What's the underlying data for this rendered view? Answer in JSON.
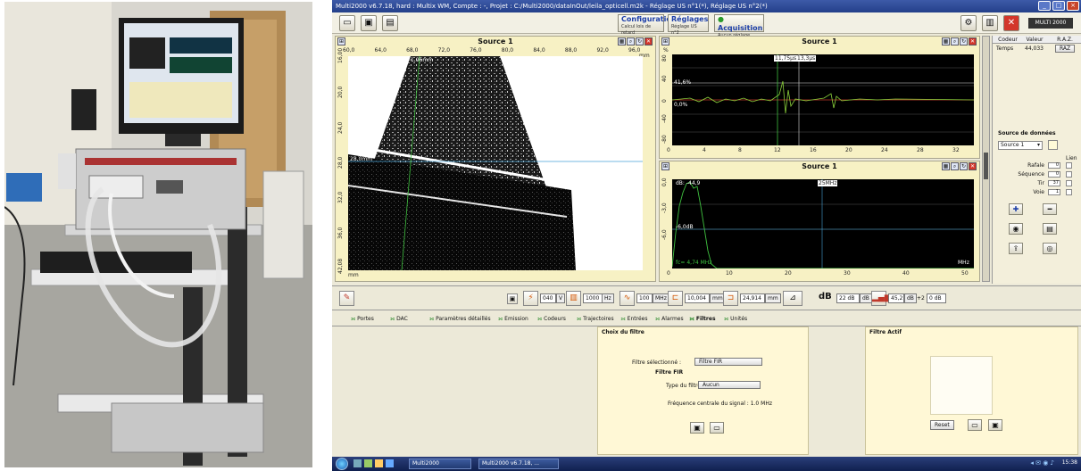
{
  "window": {
    "title": "Multi2000  v6.7.18,  hard : Multix WM, Compte : -,  Projet : C:/Multi2000/dataInOut/leila_opticell.m2k - Réglage US n°1(*), Réglage US n°2(*)"
  },
  "toolbar": {
    "configuration": {
      "title": "Configuration",
      "subtitle": "Calcul lois de retard"
    },
    "reglages": {
      "title": "Réglages",
      "subtitle": "Réglage US n°2"
    },
    "acquisition": {
      "title": "Acquisition",
      "subtitle": "Aucun réglage"
    },
    "brand": "MULTI 2000"
  },
  "panels": {
    "image": {
      "title": "Source 1",
      "xticks": [
        "60,0",
        "64,0",
        "68,0",
        "72,0",
        "76,0",
        "80,0",
        "84,0",
        "88,0",
        "92,0",
        "96,0"
      ],
      "yticks": [
        "16,00",
        "20,0",
        "24,0",
        "28,0",
        "32,0",
        "36,0",
        "42,08"
      ],
      "xunit": "mm",
      "yunit": "mm",
      "cursor_top": "1,96mm",
      "cursor_left": "28,0mm"
    },
    "ascan": {
      "title": "Source 1",
      "xticks": [
        "0",
        "4",
        "8",
        "12",
        "16",
        "20",
        "24",
        "28",
        "32"
      ],
      "yticks": [
        "80",
        "40",
        "0",
        "-40",
        "-80"
      ],
      "yunit": "%",
      "marker1": "11,75µs",
      "marker2": "13,3µs",
      "level_a": "41,6%",
      "level_b": "0,0%"
    },
    "spectrum": {
      "title": "Source 1",
      "xticks": [
        "0",
        "10",
        "20",
        "30",
        "40",
        "50"
      ],
      "yticks": [
        "0,0",
        "-3,0",
        "-6,0"
      ],
      "xunit": "MHz",
      "peak": "dB: -44,9",
      "cursor": "25MHz",
      "level": "-6,0dB",
      "fc": "fc= 4,74 MHz"
    }
  },
  "right": {
    "headers": [
      "Codeur",
      "Valeur",
      "R.A.Z."
    ],
    "row": [
      "Temps",
      "44,033",
      "RAZ"
    ],
    "source_title": "Source de données",
    "source_value": "Source 1",
    "lien_label": "Lien",
    "fields": [
      {
        "label": "Rafale",
        "value": "0"
      },
      {
        "label": "Séquence",
        "value": "0"
      },
      {
        "label": "Tir",
        "value": "37"
      },
      {
        "label": "Voie",
        "value": "1"
      }
    ]
  },
  "controls": {
    "voltage": "040",
    "voltage_unit": "V",
    "prf": "1000",
    "prf_unit": "Hz",
    "filter": "100",
    "filter_unit": "MHz",
    "gate_start": "10,004",
    "gate_start_unit": "mm",
    "gate_width": "24,914",
    "gate_width_unit": "mm",
    "db_label": "dB",
    "gain": "22 dB",
    "gain_unit": "dB",
    "gain2": "45,2",
    "gain2_unit": "dB",
    "offset_sign": "+2",
    "offset": "0 dB"
  },
  "tabs": [
    "Portes",
    "DAC",
    "Paramètres détaillés",
    "Emission",
    "Codeurs",
    "Trajectoires",
    "Entrées",
    "Alarmes",
    "Filtres",
    "Unités"
  ],
  "filter_choice": {
    "title": "Choix du filtre",
    "selected_label": "Filtre sélectionné :",
    "selected_value": "Filtre FIR",
    "fir_title": "Filtre FIR",
    "type_label": "Type du filtre",
    "type_value": "Aucun",
    "freq_text": "Fréquence centrale du signal : 1.0 MHz"
  },
  "filter_active": {
    "title": "Filtre Actif",
    "reset": "Reset"
  },
  "taskbar": {
    "task1": "Multi2000",
    "task2": "Multi2000  v6.7.18,  ...",
    "clock": "15:38"
  },
  "colors": {
    "panel_bg": "#f7f1c4",
    "signal_green": "#3fc03f",
    "accent_blue": "#1d3fa8"
  }
}
